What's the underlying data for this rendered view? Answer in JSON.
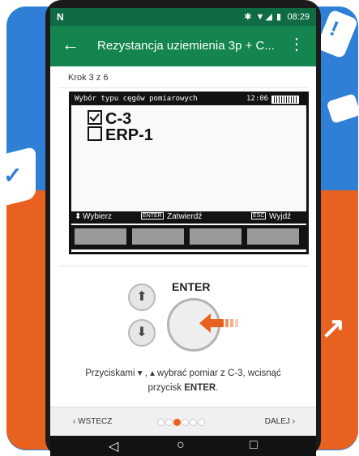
{
  "status_bar": {
    "carrier_icon": "N",
    "status_icons": "✱ ▼◢ ▮",
    "time": "08:29"
  },
  "app_bar": {
    "back_icon": "←",
    "title": "Rezystancja uziemienia 3p + C...",
    "more_icon": "⋮"
  },
  "step_label": "Krok 3 z 6",
  "device": {
    "header_label": "Wybór typu cęgów pomiarowych",
    "header_time": "12:06",
    "options": [
      {
        "label": "C-3",
        "checked": true
      },
      {
        "label": "ERP-1",
        "checked": false
      }
    ],
    "footer": {
      "select": "Wybierz",
      "enter_tag": "ENTER",
      "confirm": "Zatwierdź",
      "esc_tag": "ESC",
      "exit": "Wyjdź"
    }
  },
  "controls": {
    "up_icon": "⬆",
    "down_icon": "⬇",
    "enter_label": "ENTER"
  },
  "instruction": {
    "line1": "Przyciskami ▾ , ▴ wybrać pomiar z C-3, wcisnąć",
    "line2_prefix": "przycisk ",
    "line2_bold": "ENTER",
    "line2_suffix": "."
  },
  "nav": {
    "prev": "‹ WSTECZ",
    "next": "DALEJ ›",
    "dots_total": 6,
    "active_index": 2
  },
  "system_nav": {
    "back": "◁",
    "home": "○",
    "recents": "□"
  },
  "colors": {
    "status": "#0f6b44",
    "appbar": "#14854f",
    "accent": "#e9611e",
    "bg_blue": "#2f7fd7"
  }
}
